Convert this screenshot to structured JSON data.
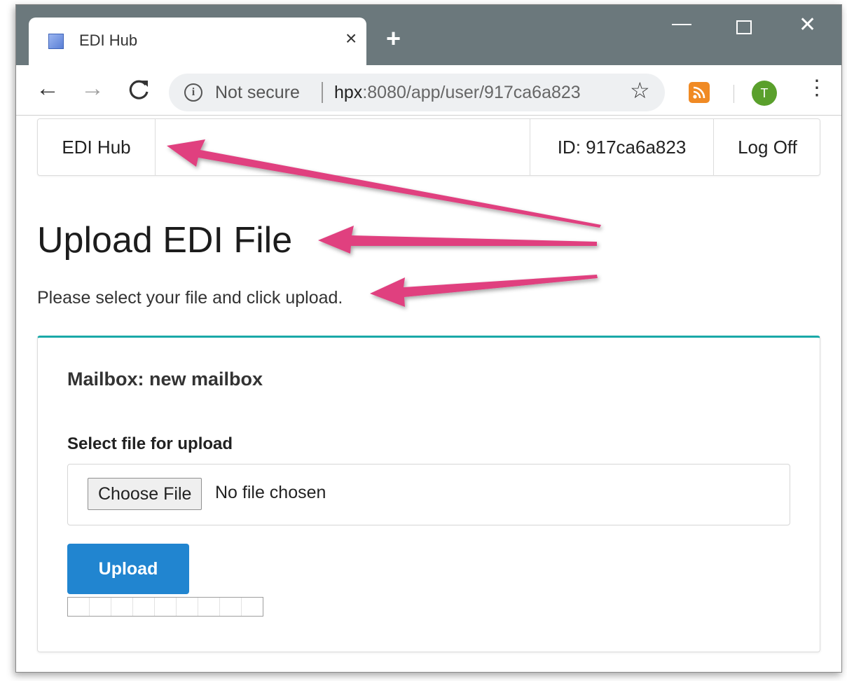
{
  "browser": {
    "tab": {
      "title": "EDI Hub",
      "close_glyph": "×"
    },
    "new_tab_glyph": "+",
    "window_controls": {
      "minimize": "—",
      "close": "✕"
    },
    "toolbar": {
      "back_glyph": "←",
      "forward_glyph": "→",
      "reload_glyph": "C",
      "security_icon_glyph": "i",
      "security_label": "Not secure",
      "url_host": "hpx",
      "url_rest": ":8080/app/user/917ca6a823",
      "star_glyph": "☆",
      "rss_glyph": "))",
      "profile_initial": "T",
      "menu_glyph": "⋮"
    },
    "icons": [
      "favicon-icon",
      "close-icon",
      "plus-icon",
      "back-icon",
      "forward-icon",
      "reload-icon",
      "info-icon",
      "star-icon",
      "rss-icon",
      "menu-icon"
    ]
  },
  "app": {
    "nav": {
      "brand": "EDI Hub",
      "user_id": "ID: 917ca6a823",
      "logoff": "Log Off"
    },
    "page": {
      "title": "Upload EDI File",
      "subtitle": "Please select your file and click upload."
    },
    "card": {
      "mailbox": "Mailbox: new mailbox",
      "file_label": "Select file for upload",
      "choose_button": "Choose File",
      "no_file_text": "No file chosen",
      "upload_button": "Upload",
      "progress": 0
    }
  },
  "colors": {
    "titlebar": "#6b787c",
    "accent_teal": "#1aa9a8",
    "upload_blue": "#2185d0",
    "annotation_arrow": "#e0407f",
    "profile_green": "#5aa02c",
    "rss_orange": "#f08a24"
  }
}
